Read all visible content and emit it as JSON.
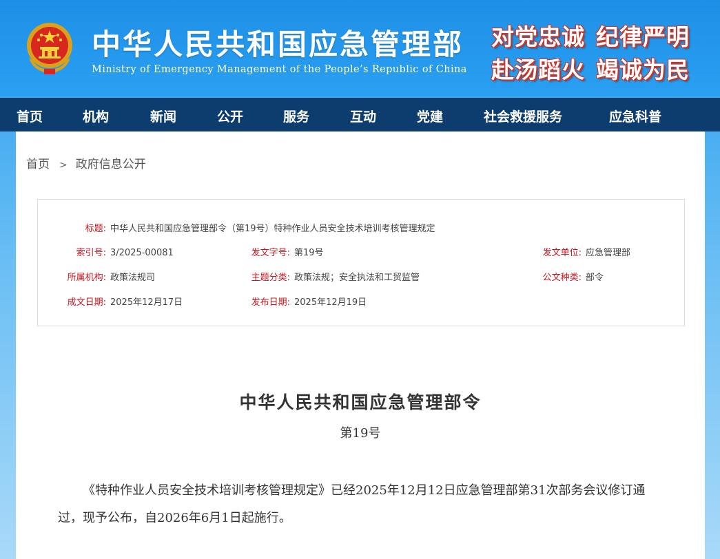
{
  "header": {
    "title": "中华人民共和国应急管理部",
    "subtitle": "Ministry of Emergency Management of the People’s Republic of China",
    "slogan_line1": [
      "对党忠诚",
      "纪律严明"
    ],
    "slogan_line2": [
      "赴汤蹈火",
      "竭诚为民"
    ]
  },
  "colors": {
    "header_blue": "#2aa0f2",
    "nav_navy": "#0c3d6e",
    "meta_key_red": "#c8161e",
    "slogan_outline": "#c9342a"
  },
  "nav": {
    "items": [
      "首页",
      "机构",
      "新闻",
      "公开",
      "服务",
      "互动",
      "党建",
      "社会救援服务",
      "应急科普"
    ]
  },
  "breadcrumb": {
    "home": "首页",
    "separator": ">",
    "current": "政府信息公开"
  },
  "meta": {
    "title_key": "标题:",
    "title_value": "中华人民共和国应急管理部令（第19号）特种作业人员安全技术培训考核管理规定",
    "index_key": "索引号:",
    "index_value": "3/2025-00081",
    "docno_key": "发文字号:",
    "docno_value": "第19号",
    "issuer_key": "发文单位:",
    "issuer_value": "应急管理部",
    "org_key": "所属机构:",
    "org_value": "政策法规司",
    "topic_key": "主题分类:",
    "topic_value": "政策法规；安全执法和工贸监管",
    "type_key": "公文种类:",
    "type_value": "部令",
    "written_key": "成文日期:",
    "written_value": "2025年12月17日",
    "published_key": "发布日期:",
    "published_value": "2025年12月19日"
  },
  "document": {
    "title": "中华人民共和国应急管理部令",
    "number": "第19号",
    "body": "《特种作业人员安全技术培训考核管理规定》已经2025年12月12日应急管理部第31次部务会议修订通过，现予公布，自2026年6月1日起施行。"
  }
}
